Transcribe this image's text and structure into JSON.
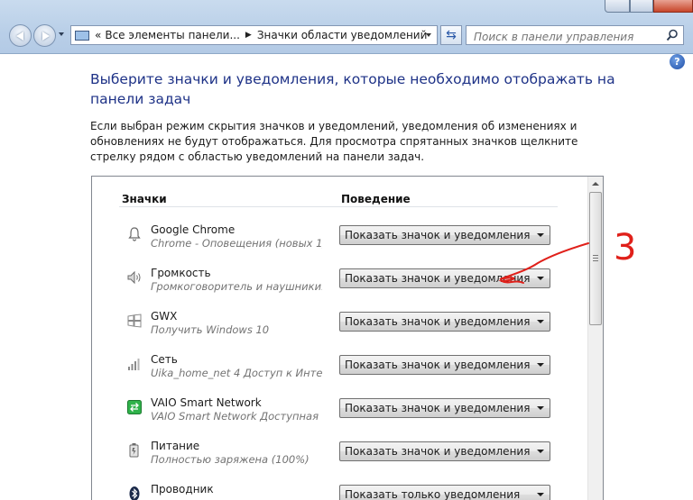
{
  "address": {
    "crumbs": [
      "Все элементы панели...",
      "Значки области уведомлений"
    ],
    "breadcrumb_prefix": "«"
  },
  "search": {
    "placeholder": "Поиск в панели управления"
  },
  "page": {
    "title": "Выберите значки и уведомления, которые необходимо отображать на панели задач",
    "description": "Если выбран режим скрытия значков и уведомлений, уведомления об изменениях и обновлениях не будут отображаться. Для просмотра спрятанных значков щелкните стрелку рядом с областью уведомлений на панели задач."
  },
  "table": {
    "col_icons": "Значки",
    "col_behavior": "Поведение",
    "rows": [
      {
        "name": "Google Chrome",
        "sub": "Chrome - Оповещения (новых 1)",
        "behavior": "Показать значок и уведомления",
        "icon": "bell-icon"
      },
      {
        "name": "Громкость",
        "sub": "Громкоговоритель и наушники: ...",
        "behavior": "Показать значок и уведомления",
        "icon": "speaker-icon"
      },
      {
        "name": "GWX",
        "sub": "Получить Windows 10",
        "behavior": "Показать значок и уведомления",
        "icon": "windows-icon"
      },
      {
        "name": "Сеть",
        "sub": "Uika_home_net  4 Доступ к Инте...",
        "behavior": "Показать значок и уведомления",
        "icon": "network-icon"
      },
      {
        "name": "VAIO Smart Network",
        "sub": "VAIO Smart Network  Доступная ...",
        "behavior": "Показать значок и уведомления",
        "icon": "vaio-network-icon"
      },
      {
        "name": "Питание",
        "sub": "Полностью заряжена (100%)",
        "behavior": "Показать значок и уведомления",
        "icon": "battery-icon"
      },
      {
        "name": "Проводник",
        "sub": "",
        "behavior": "Показать только уведомления",
        "icon": "bluetooth-icon"
      }
    ]
  },
  "annotation": {
    "text": "3",
    "color": "#e0201a"
  },
  "colors": {
    "title": "#1e3287",
    "frame": "#b9cfe8"
  }
}
